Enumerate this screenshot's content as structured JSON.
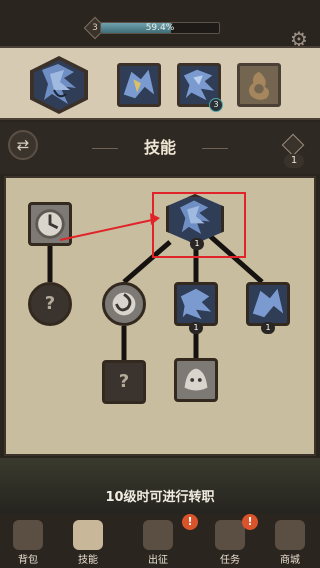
{
  "header": {
    "level": "3",
    "xp_percent_text": "59.4%",
    "xp_fraction": 0.594
  },
  "characters": {
    "badge_count": "3"
  },
  "section": {
    "title": "技能",
    "skill_points": "1"
  },
  "tree": {
    "ranks": [
      "1",
      "1",
      "1"
    ],
    "unknown_mark": "?"
  },
  "footer": {
    "unlock_message": "10级时可进行转职"
  },
  "nav": {
    "items": [
      {
        "label": "背包"
      },
      {
        "label": "技能"
      },
      {
        "label": "出征"
      },
      {
        "label": "任务"
      },
      {
        "label": "商城"
      }
    ],
    "alert_mark": "!"
  },
  "colors": {
    "highlight": "#e0242a",
    "accent_teal": "#4ea6a8",
    "alert": "#d9542b"
  }
}
